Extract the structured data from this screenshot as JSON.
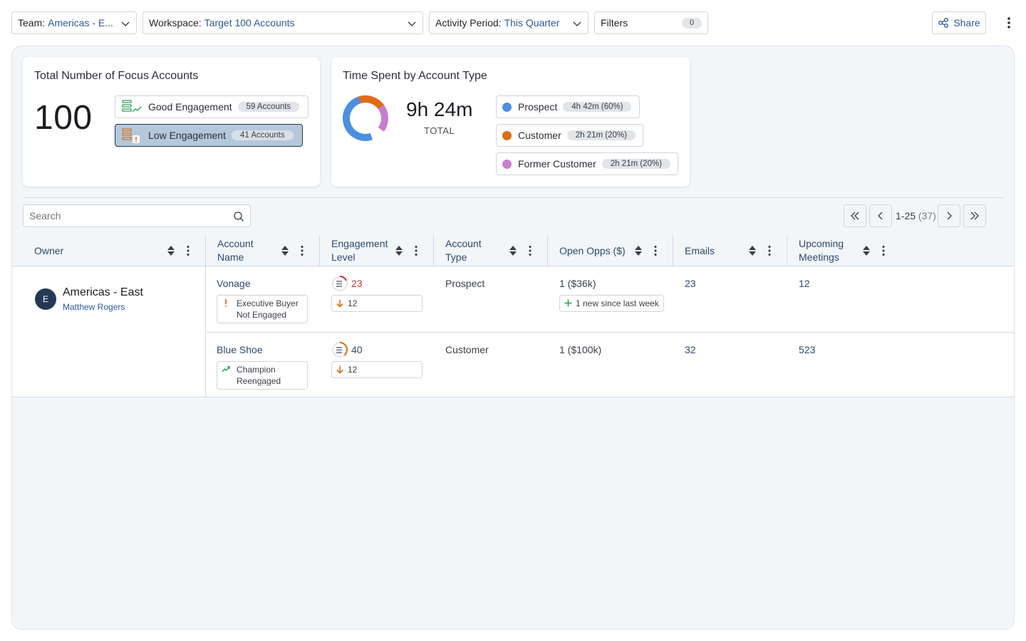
{
  "toolbar": {
    "team": {
      "label": "Team:",
      "value": "Americas - E..."
    },
    "workspace": {
      "label": "Workspace:",
      "value": "Target 100 Accounts"
    },
    "activity": {
      "label": "Activity Period:",
      "value": "This Quarter"
    },
    "filters": {
      "label": "Filters",
      "count": "0"
    },
    "share_label": "Share"
  },
  "focus_card": {
    "title": "Total Number of Focus Accounts",
    "total": "100",
    "segments": [
      {
        "label": "Good Engagement",
        "count": "59 Accounts",
        "icon": "good-engagement-icon"
      },
      {
        "label": "Low Engagement",
        "count": "41 Accounts",
        "icon": "low-engagement-icon",
        "selected": true
      }
    ]
  },
  "time_card": {
    "title": "Time Spent by Account Type",
    "total": "9h 24m",
    "total_label": "TOTAL",
    "types": [
      {
        "label": "Prospect",
        "value": "4h 42m (60%)",
        "color": "#4a8fe2",
        "share": 60
      },
      {
        "label": "Customer",
        "value": "2h 21m (20%)",
        "color": "#e06c12",
        "share": 20
      },
      {
        "label": "Former Customer",
        "value": "2h 21m (20%)",
        "color": "#c77dd1",
        "share": 20
      }
    ]
  },
  "search": {
    "placeholder": "Search"
  },
  "pagination": {
    "range": "1-25",
    "total": "(37)"
  },
  "columns": [
    {
      "label": "Owner"
    },
    {
      "label": "Account Name"
    },
    {
      "label": "Engagement Level"
    },
    {
      "label": "Account Type"
    },
    {
      "label": "Open Opps ($)"
    },
    {
      "label": "Emails"
    },
    {
      "label": "Upcoming Meetings"
    }
  ],
  "owner": {
    "initial": "E",
    "name": "Americas - East",
    "sub": "Matthew Rogers"
  },
  "rows": [
    {
      "account": "Vonage",
      "badge": "Executive Buyer Not Engaged",
      "badge_type": "warning",
      "engagement": "23",
      "engagement_color": "#c8372d",
      "engagement_delta": "12",
      "type": "Prospect",
      "opps": "1 ($36k)",
      "opps_note": "1 new since last week",
      "emails": "23",
      "meetings": "12"
    },
    {
      "account": "Blue Shoe",
      "badge": "Champion Reengaged",
      "badge_type": "trend-up",
      "engagement": "40",
      "engagement_color": "#2c4a6e",
      "engagement_delta": "12",
      "type": "Customer",
      "opps": "1 ($100k)",
      "emails": "32",
      "meetings": "523"
    }
  ]
}
